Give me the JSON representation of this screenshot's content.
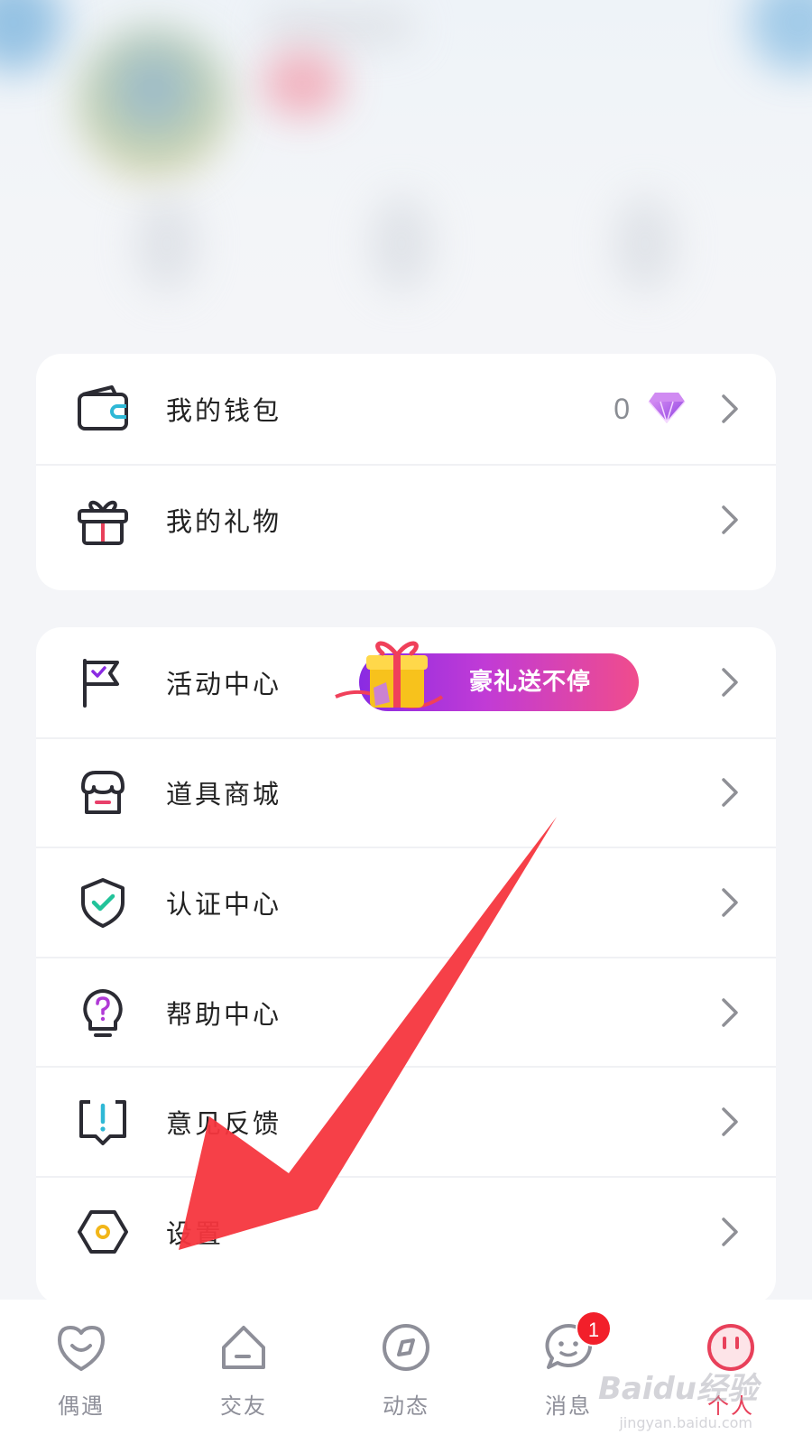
{
  "menu_group_1": {
    "wallet": {
      "label": "我的钱包",
      "count": "0",
      "icon": "wallet-icon"
    },
    "gifts": {
      "label": "我的礼物",
      "icon": "gift-icon"
    }
  },
  "menu_group_2": {
    "activity": {
      "label": "活动中心",
      "promo_text": "豪礼送不停",
      "icon": "flag-icon"
    },
    "shop": {
      "label": "道具商城",
      "icon": "store-icon"
    },
    "verify": {
      "label": "认证中心",
      "icon": "shield-check-icon"
    },
    "help": {
      "label": "帮助中心",
      "icon": "question-bulb-icon"
    },
    "feedback": {
      "label": "意见反馈",
      "icon": "feedback-icon"
    },
    "settings": {
      "label": "设置",
      "icon": "settings-hex-icon"
    }
  },
  "bottom_nav": {
    "items": [
      {
        "label": "偶遇",
        "icon": "heart-face-icon"
      },
      {
        "label": "交友",
        "icon": "house-icon"
      },
      {
        "label": "动态",
        "icon": "compass-icon"
      },
      {
        "label": "消息",
        "icon": "chat-face-icon",
        "badge": "1"
      },
      {
        "label": "个人",
        "icon": "profile-face-icon",
        "active": true
      }
    ]
  },
  "watermark": {
    "text": "Baidu经验",
    "sub": "jingyan.baidu.com"
  },
  "colors": {
    "accent": "#e8405a",
    "icon_stroke": "#2b2b33",
    "wallet_accent": "#2fb8d6",
    "gift_accent": "#e8405a",
    "flag_accent": "#8a2be2",
    "shop_accent": "#e8406a",
    "shield_accent": "#22c39a",
    "help_accent": "#b03ad6",
    "settings_accent": "#f2b619",
    "badge": "#f21f2a",
    "arrow": "#f5363e"
  }
}
